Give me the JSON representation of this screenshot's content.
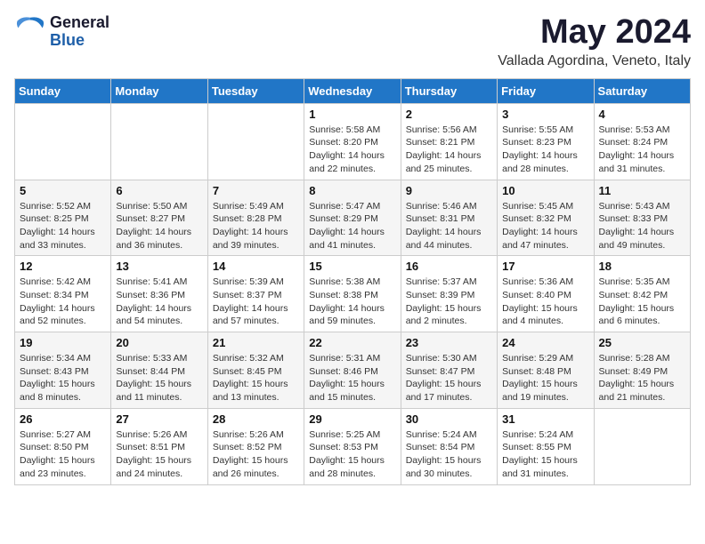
{
  "logo": {
    "general": "General",
    "blue": "Blue"
  },
  "title": "May 2024",
  "location": "Vallada Agordina, Veneto, Italy",
  "weekdays": [
    "Sunday",
    "Monday",
    "Tuesday",
    "Wednesday",
    "Thursday",
    "Friday",
    "Saturday"
  ],
  "weeks": [
    [
      {
        "day": "",
        "sunrise": "",
        "sunset": "",
        "daylight": ""
      },
      {
        "day": "",
        "sunrise": "",
        "sunset": "",
        "daylight": ""
      },
      {
        "day": "",
        "sunrise": "",
        "sunset": "",
        "daylight": ""
      },
      {
        "day": "1",
        "sunrise": "Sunrise: 5:58 AM",
        "sunset": "Sunset: 8:20 PM",
        "daylight": "Daylight: 14 hours and 22 minutes."
      },
      {
        "day": "2",
        "sunrise": "Sunrise: 5:56 AM",
        "sunset": "Sunset: 8:21 PM",
        "daylight": "Daylight: 14 hours and 25 minutes."
      },
      {
        "day": "3",
        "sunrise": "Sunrise: 5:55 AM",
        "sunset": "Sunset: 8:23 PM",
        "daylight": "Daylight: 14 hours and 28 minutes."
      },
      {
        "day": "4",
        "sunrise": "Sunrise: 5:53 AM",
        "sunset": "Sunset: 8:24 PM",
        "daylight": "Daylight: 14 hours and 31 minutes."
      }
    ],
    [
      {
        "day": "5",
        "sunrise": "Sunrise: 5:52 AM",
        "sunset": "Sunset: 8:25 PM",
        "daylight": "Daylight: 14 hours and 33 minutes."
      },
      {
        "day": "6",
        "sunrise": "Sunrise: 5:50 AM",
        "sunset": "Sunset: 8:27 PM",
        "daylight": "Daylight: 14 hours and 36 minutes."
      },
      {
        "day": "7",
        "sunrise": "Sunrise: 5:49 AM",
        "sunset": "Sunset: 8:28 PM",
        "daylight": "Daylight: 14 hours and 39 minutes."
      },
      {
        "day": "8",
        "sunrise": "Sunrise: 5:47 AM",
        "sunset": "Sunset: 8:29 PM",
        "daylight": "Daylight: 14 hours and 41 minutes."
      },
      {
        "day": "9",
        "sunrise": "Sunrise: 5:46 AM",
        "sunset": "Sunset: 8:31 PM",
        "daylight": "Daylight: 14 hours and 44 minutes."
      },
      {
        "day": "10",
        "sunrise": "Sunrise: 5:45 AM",
        "sunset": "Sunset: 8:32 PM",
        "daylight": "Daylight: 14 hours and 47 minutes."
      },
      {
        "day": "11",
        "sunrise": "Sunrise: 5:43 AM",
        "sunset": "Sunset: 8:33 PM",
        "daylight": "Daylight: 14 hours and 49 minutes."
      }
    ],
    [
      {
        "day": "12",
        "sunrise": "Sunrise: 5:42 AM",
        "sunset": "Sunset: 8:34 PM",
        "daylight": "Daylight: 14 hours and 52 minutes."
      },
      {
        "day": "13",
        "sunrise": "Sunrise: 5:41 AM",
        "sunset": "Sunset: 8:36 PM",
        "daylight": "Daylight: 14 hours and 54 minutes."
      },
      {
        "day": "14",
        "sunrise": "Sunrise: 5:39 AM",
        "sunset": "Sunset: 8:37 PM",
        "daylight": "Daylight: 14 hours and 57 minutes."
      },
      {
        "day": "15",
        "sunrise": "Sunrise: 5:38 AM",
        "sunset": "Sunset: 8:38 PM",
        "daylight": "Daylight: 14 hours and 59 minutes."
      },
      {
        "day": "16",
        "sunrise": "Sunrise: 5:37 AM",
        "sunset": "Sunset: 8:39 PM",
        "daylight": "Daylight: 15 hours and 2 minutes."
      },
      {
        "day": "17",
        "sunrise": "Sunrise: 5:36 AM",
        "sunset": "Sunset: 8:40 PM",
        "daylight": "Daylight: 15 hours and 4 minutes."
      },
      {
        "day": "18",
        "sunrise": "Sunrise: 5:35 AM",
        "sunset": "Sunset: 8:42 PM",
        "daylight": "Daylight: 15 hours and 6 minutes."
      }
    ],
    [
      {
        "day": "19",
        "sunrise": "Sunrise: 5:34 AM",
        "sunset": "Sunset: 8:43 PM",
        "daylight": "Daylight: 15 hours and 8 minutes."
      },
      {
        "day": "20",
        "sunrise": "Sunrise: 5:33 AM",
        "sunset": "Sunset: 8:44 PM",
        "daylight": "Daylight: 15 hours and 11 minutes."
      },
      {
        "day": "21",
        "sunrise": "Sunrise: 5:32 AM",
        "sunset": "Sunset: 8:45 PM",
        "daylight": "Daylight: 15 hours and 13 minutes."
      },
      {
        "day": "22",
        "sunrise": "Sunrise: 5:31 AM",
        "sunset": "Sunset: 8:46 PM",
        "daylight": "Daylight: 15 hours and 15 minutes."
      },
      {
        "day": "23",
        "sunrise": "Sunrise: 5:30 AM",
        "sunset": "Sunset: 8:47 PM",
        "daylight": "Daylight: 15 hours and 17 minutes."
      },
      {
        "day": "24",
        "sunrise": "Sunrise: 5:29 AM",
        "sunset": "Sunset: 8:48 PM",
        "daylight": "Daylight: 15 hours and 19 minutes."
      },
      {
        "day": "25",
        "sunrise": "Sunrise: 5:28 AM",
        "sunset": "Sunset: 8:49 PM",
        "daylight": "Daylight: 15 hours and 21 minutes."
      }
    ],
    [
      {
        "day": "26",
        "sunrise": "Sunrise: 5:27 AM",
        "sunset": "Sunset: 8:50 PM",
        "daylight": "Daylight: 15 hours and 23 minutes."
      },
      {
        "day": "27",
        "sunrise": "Sunrise: 5:26 AM",
        "sunset": "Sunset: 8:51 PM",
        "daylight": "Daylight: 15 hours and 24 minutes."
      },
      {
        "day": "28",
        "sunrise": "Sunrise: 5:26 AM",
        "sunset": "Sunset: 8:52 PM",
        "daylight": "Daylight: 15 hours and 26 minutes."
      },
      {
        "day": "29",
        "sunrise": "Sunrise: 5:25 AM",
        "sunset": "Sunset: 8:53 PM",
        "daylight": "Daylight: 15 hours and 28 minutes."
      },
      {
        "day": "30",
        "sunrise": "Sunrise: 5:24 AM",
        "sunset": "Sunset: 8:54 PM",
        "daylight": "Daylight: 15 hours and 30 minutes."
      },
      {
        "day": "31",
        "sunrise": "Sunrise: 5:24 AM",
        "sunset": "Sunset: 8:55 PM",
        "daylight": "Daylight: 15 hours and 31 minutes."
      },
      {
        "day": "",
        "sunrise": "",
        "sunset": "",
        "daylight": ""
      }
    ]
  ]
}
